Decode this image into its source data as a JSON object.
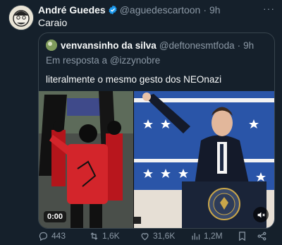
{
  "tweet": {
    "author_name": "André Guedes",
    "handle": "@aguedescartoon",
    "separator": "·",
    "time": "9h",
    "text": "Caraio",
    "more_label": "···"
  },
  "quote": {
    "author_name": "venvansinho da silva",
    "handle": "@deftonesmtfoda",
    "separator": "·",
    "time": "9h",
    "reply_prefix": "Em resposta a",
    "reply_to": "@izzynobre",
    "text": "literalmente o mesmo gesto dos NEOnazi",
    "video_timestamp": "0:00"
  },
  "actions": {
    "replies": "443",
    "retweets": "1,6K",
    "likes": "31,6K",
    "views": "1,2M"
  },
  "colors": {
    "background": "#15202b",
    "verified": "#1d9bf0",
    "muted_text": "#8b98a5",
    "border": "#38444d"
  }
}
